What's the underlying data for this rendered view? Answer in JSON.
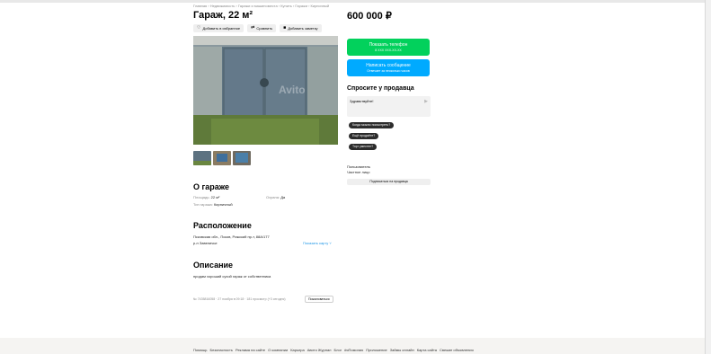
{
  "breadcrumb": "Главная › Недвижимость › Гаражи и машиноместа › Купить › Гаражи › Кирпичный",
  "title": "Гараж, 22 м²",
  "actions": {
    "favorite": "Добавить в избранное",
    "compare": "Сравнить",
    "note": "Добавить заметку"
  },
  "price": "600 000 ₽",
  "phone_button": {
    "label": "Показать телефон",
    "sub": "8 XXX XXX-XX-XX"
  },
  "message_button": {
    "label": "Написать сообщение",
    "sub": "Отвечает за несколько часов"
  },
  "ask_seller": {
    "title": "Спросите у продавца",
    "message": "Здравствуйте!",
    "chips": [
      "Когда можно посмотреть?",
      "Ещё продаёте?",
      "Торг уместен?"
    ]
  },
  "seller": {
    "name": "Пользователь",
    "type": "Частное лицо",
    "subscribe": "Подписаться на продавца"
  },
  "about": {
    "title": "О гараже",
    "area_label": "Площадь:",
    "area_value": "22 м²",
    "security_label": "Охрана:",
    "security_value": "Да",
    "type_label": "Тип гаража:",
    "type_value": "Кирпичный"
  },
  "location": {
    "title": "Расположение",
    "address": "Псковская обл., Псков, Рижский пр-т, 88А/177",
    "district": "р-н Завеличье",
    "map_link": "Показать карту"
  },
  "description": {
    "title": "Описание",
    "text": "продам хороший сухой гараж от собственника"
  },
  "meta": {
    "text": "№ 7435816058 · 27 ноября в 09:18 · 181 просмотр (+3 сегодня)",
    "report": "Пожаловаться"
  },
  "footer": [
    "Помощь",
    "Безопасность",
    "Реклама на сайте",
    "О компании",
    "Карьера",
    "Авито Журнал",
    "Блог",
    "#яПомогаю",
    "Приложение",
    "Займы онлайн",
    "Карта сайта",
    "Свежие объявления"
  ],
  "colors": {
    "green": "#02d15c",
    "blue": "#00aaff",
    "link": "#1e96e6"
  },
  "icons": {
    "favorite": "heart-icon",
    "compare": "compare-icon",
    "note": "note-icon",
    "send": "send-icon"
  }
}
